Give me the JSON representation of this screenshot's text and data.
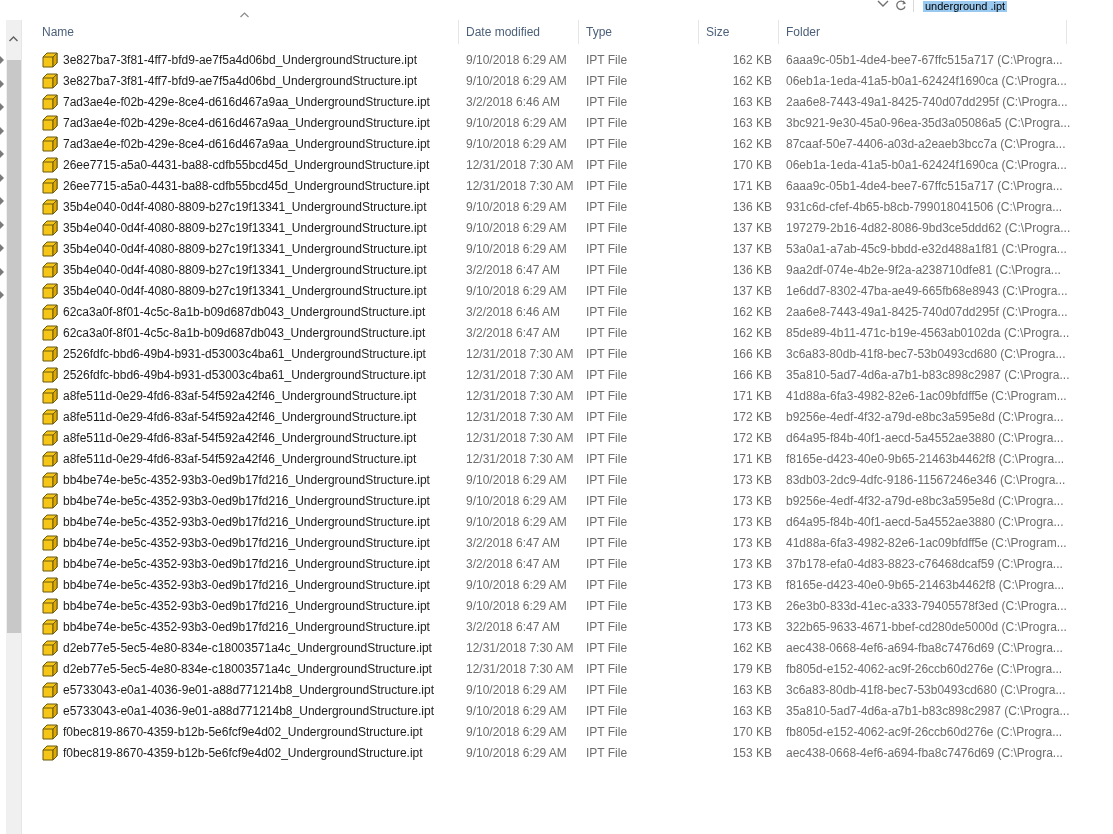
{
  "search": {
    "value": "underground .ipt"
  },
  "table": {
    "columns": [
      {
        "label": "Name",
        "sorted": true
      },
      {
        "label": "Date modified",
        "sorted": false
      },
      {
        "label": "Type",
        "sorted": false
      },
      {
        "label": "Size",
        "sorted": false
      },
      {
        "label": "Folder",
        "sorted": false
      }
    ],
    "rows": [
      {
        "name": "3e827ba7-3f81-4ff7-bfd9-ae7f5a4d06bd_UndergroundStructure.ipt",
        "date": "9/10/2018 6:29 AM",
        "type": "IPT File",
        "size": "162 KB",
        "folder": "6aaa9c-05b1-4de4-bee7-67ffc515a717 (C:\\Progra..."
      },
      {
        "name": "3e827ba7-3f81-4ff7-bfd9-ae7f5a4d06bd_UndergroundStructure.ipt",
        "date": "9/10/2018 6:29 AM",
        "type": "IPT File",
        "size": "162 KB",
        "folder": "06eb1a-1eda-41a5-b0a1-62424f1690ca (C:\\Progra..."
      },
      {
        "name": "7ad3ae4e-f02b-429e-8ce4-d616d467a9aa_UndergroundStructure.ipt",
        "date": "3/2/2018 6:46 AM",
        "type": "IPT File",
        "size": "163 KB",
        "folder": "2aa6e8-7443-49a1-8425-740d07dd295f (C:\\Progra..."
      },
      {
        "name": "7ad3ae4e-f02b-429e-8ce4-d616d467a9aa_UndergroundStructure.ipt",
        "date": "9/10/2018 6:29 AM",
        "type": "IPT File",
        "size": "163 KB",
        "folder": "3bc921-9e30-45a0-96ea-35d3a05086a5 (C:\\Progra..."
      },
      {
        "name": "7ad3ae4e-f02b-429e-8ce4-d616d467a9aa_UndergroundStructure.ipt",
        "date": "9/10/2018 6:29 AM",
        "type": "IPT File",
        "size": "162 KB",
        "folder": "87caaf-50e7-4406-a03d-a2eaeb3bcc7a (C:\\Progra..."
      },
      {
        "name": "26ee7715-a5a0-4431-ba88-cdfb55bcd45d_UndergroundStructure.ipt",
        "date": "12/31/2018 7:30 AM",
        "type": "IPT File",
        "size": "170 KB",
        "folder": "06eb1a-1eda-41a5-b0a1-62424f1690ca (C:\\Progra..."
      },
      {
        "name": "26ee7715-a5a0-4431-ba88-cdfb55bcd45d_UndergroundStructure.ipt",
        "date": "12/31/2018 7:30 AM",
        "type": "IPT File",
        "size": "171 KB",
        "folder": "6aaa9c-05b1-4de4-bee7-67ffc515a717 (C:\\Progra..."
      },
      {
        "name": "35b4e040-0d4f-4080-8809-b27c19f13341_UndergroundStructure.ipt",
        "date": "9/10/2018 6:29 AM",
        "type": "IPT File",
        "size": "136 KB",
        "folder": "931c6d-cfef-4b65-b8cb-799018041506 (C:\\Progra..."
      },
      {
        "name": "35b4e040-0d4f-4080-8809-b27c19f13341_UndergroundStructure.ipt",
        "date": "9/10/2018 6:29 AM",
        "type": "IPT File",
        "size": "137 KB",
        "folder": "197279-2b16-4d82-8086-9bd3ce5ddd62 (C:\\Progra..."
      },
      {
        "name": "35b4e040-0d4f-4080-8809-b27c19f13341_UndergroundStructure.ipt",
        "date": "9/10/2018 6:29 AM",
        "type": "IPT File",
        "size": "137 KB",
        "folder": "53a0a1-a7ab-45c9-bbdd-e32d488a1f81 (C:\\Progra..."
      },
      {
        "name": "35b4e040-0d4f-4080-8809-b27c19f13341_UndergroundStructure.ipt",
        "date": "3/2/2018 6:47 AM",
        "type": "IPT File",
        "size": "136 KB",
        "folder": "9aa2df-074e-4b2e-9f2a-a238710dfe81 (C:\\Progra..."
      },
      {
        "name": "35b4e040-0d4f-4080-8809-b27c19f13341_UndergroundStructure.ipt",
        "date": "9/10/2018 6:29 AM",
        "type": "IPT File",
        "size": "137 KB",
        "folder": "1e6dd7-8302-47ba-ae49-665fb68e8943 (C:\\Progra..."
      },
      {
        "name": "62ca3a0f-8f01-4c5c-8a1b-b09d687db043_UndergroundStructure.ipt",
        "date": "3/2/2018 6:46 AM",
        "type": "IPT File",
        "size": "162 KB",
        "folder": "2aa6e8-7443-49a1-8425-740d07dd295f (C:\\Progra..."
      },
      {
        "name": "62ca3a0f-8f01-4c5c-8a1b-b09d687db043_UndergroundStructure.ipt",
        "date": "3/2/2018 6:47 AM",
        "type": "IPT File",
        "size": "162 KB",
        "folder": "85de89-4b11-471c-b19e-4563ab0102da (C:\\Progra..."
      },
      {
        "name": "2526fdfc-bbd6-49b4-b931-d53003c4ba61_UndergroundStructure.ipt",
        "date": "12/31/2018 7:30 AM",
        "type": "IPT File",
        "size": "166 KB",
        "folder": "3c6a83-80db-41f8-bec7-53b0493cd680 (C:\\Progra..."
      },
      {
        "name": "2526fdfc-bbd6-49b4-b931-d53003c4ba61_UndergroundStructure.ipt",
        "date": "12/31/2018 7:30 AM",
        "type": "IPT File",
        "size": "166 KB",
        "folder": "35a810-5ad7-4d6a-a7b1-b83c898c2987 (C:\\Progra..."
      },
      {
        "name": "a8fe511d-0e29-4fd6-83af-54f592a42f46_UndergroundStructure.ipt",
        "date": "12/31/2018 7:30 AM",
        "type": "IPT File",
        "size": "171 KB",
        "folder": "41d88a-6fa3-4982-82e6-1ac09bfdff5e (C:\\Program..."
      },
      {
        "name": "a8fe511d-0e29-4fd6-83af-54f592a42f46_UndergroundStructure.ipt",
        "date": "12/31/2018 7:30 AM",
        "type": "IPT File",
        "size": "172 KB",
        "folder": "b9256e-4edf-4f32-a79d-e8bc3a595e8d (C:\\Progra..."
      },
      {
        "name": "a8fe511d-0e29-4fd6-83af-54f592a42f46_UndergroundStructure.ipt",
        "date": "12/31/2018 7:30 AM",
        "type": "IPT File",
        "size": "172 KB",
        "folder": "d64a95-f84b-40f1-aecd-5a4552ae3880 (C:\\Progra..."
      },
      {
        "name": "a8fe511d-0e29-4fd6-83af-54f592a42f46_UndergroundStructure.ipt",
        "date": "12/31/2018 7:30 AM",
        "type": "IPT File",
        "size": "171 KB",
        "folder": "f8165e-d423-40e0-9b65-21463b4462f8 (C:\\Progra..."
      },
      {
        "name": "bb4be74e-be5c-4352-93b3-0ed9b17fd216_UndergroundStructure.ipt",
        "date": "9/10/2018 6:29 AM",
        "type": "IPT File",
        "size": "173 KB",
        "folder": "83db03-2dc9-4dfc-9186-11567246e346 (C:\\Progra..."
      },
      {
        "name": "bb4be74e-be5c-4352-93b3-0ed9b17fd216_UndergroundStructure.ipt",
        "date": "9/10/2018 6:29 AM",
        "type": "IPT File",
        "size": "173 KB",
        "folder": "b9256e-4edf-4f32-a79d-e8bc3a595e8d (C:\\Progra..."
      },
      {
        "name": "bb4be74e-be5c-4352-93b3-0ed9b17fd216_UndergroundStructure.ipt",
        "date": "9/10/2018 6:29 AM",
        "type": "IPT File",
        "size": "173 KB",
        "folder": "d64a95-f84b-40f1-aecd-5a4552ae3880 (C:\\Progra..."
      },
      {
        "name": "bb4be74e-be5c-4352-93b3-0ed9b17fd216_UndergroundStructure.ipt",
        "date": "3/2/2018 6:47 AM",
        "type": "IPT File",
        "size": "173 KB",
        "folder": "41d88a-6fa3-4982-82e6-1ac09bfdff5e (C:\\Program..."
      },
      {
        "name": "bb4be74e-be5c-4352-93b3-0ed9b17fd216_UndergroundStructure.ipt",
        "date": "3/2/2018 6:47 AM",
        "type": "IPT File",
        "size": "173 KB",
        "folder": "37b178-efa0-4d83-8823-c76468dcaf59 (C:\\Progra..."
      },
      {
        "name": "bb4be74e-be5c-4352-93b3-0ed9b17fd216_UndergroundStructure.ipt",
        "date": "9/10/2018 6:29 AM",
        "type": "IPT File",
        "size": "173 KB",
        "folder": "f8165e-d423-40e0-9b65-21463b4462f8 (C:\\Progra..."
      },
      {
        "name": "bb4be74e-be5c-4352-93b3-0ed9b17fd216_UndergroundStructure.ipt",
        "date": "9/10/2018 6:29 AM",
        "type": "IPT File",
        "size": "173 KB",
        "folder": "26e3b0-833d-41ec-a333-79405578f3ed (C:\\Progra..."
      },
      {
        "name": "bb4be74e-be5c-4352-93b3-0ed9b17fd216_UndergroundStructure.ipt",
        "date": "3/2/2018 6:47 AM",
        "type": "IPT File",
        "size": "173 KB",
        "folder": "322b65-9633-4671-bbef-cd280de5000d (C:\\Progra..."
      },
      {
        "name": "d2eb77e5-5ec5-4e80-834e-c18003571a4c_UndergroundStructure.ipt",
        "date": "12/31/2018 7:30 AM",
        "type": "IPT File",
        "size": "162 KB",
        "folder": "aec438-0668-4ef6-a694-fba8c7476d69 (C:\\Progra..."
      },
      {
        "name": "d2eb77e5-5ec5-4e80-834e-c18003571a4c_UndergroundStructure.ipt",
        "date": "12/31/2018 7:30 AM",
        "type": "IPT File",
        "size": "179 KB",
        "folder": "fb805d-e152-4062-ac9f-26ccb60d276e (C:\\Progra..."
      },
      {
        "name": "e5733043-e0a1-4036-9e01-a88d771214b8_UndergroundStructure.ipt",
        "date": "9/10/2018 6:29 AM",
        "type": "IPT File",
        "size": "163 KB",
        "folder": "3c6a83-80db-41f8-bec7-53b0493cd680 (C:\\Progra..."
      },
      {
        "name": "e5733043-e0a1-4036-9e01-a88d771214b8_UndergroundStructure.ipt",
        "date": "9/10/2018 6:29 AM",
        "type": "IPT File",
        "size": "163 KB",
        "folder": "35a810-5ad7-4d6a-a7b1-b83c898c2987 (C:\\Progra..."
      },
      {
        "name": "f0bec819-8670-4359-b12b-5e6fcf9e4d02_UndergroundStructure.ipt",
        "date": "9/10/2018 6:29 AM",
        "type": "IPT File",
        "size": "170 KB",
        "folder": "fb805d-e152-4062-ac9f-26ccb60d276e (C:\\Progra..."
      },
      {
        "name": "f0bec819-8670-4359-b12b-5e6fcf9e4d02_UndergroundStructure.ipt",
        "date": "9/10/2018 6:29 AM",
        "type": "IPT File",
        "size": "153 KB",
        "folder": "aec438-0668-4ef6-a694-fba8c7476d69 (C:\\Progra..."
      }
    ]
  }
}
